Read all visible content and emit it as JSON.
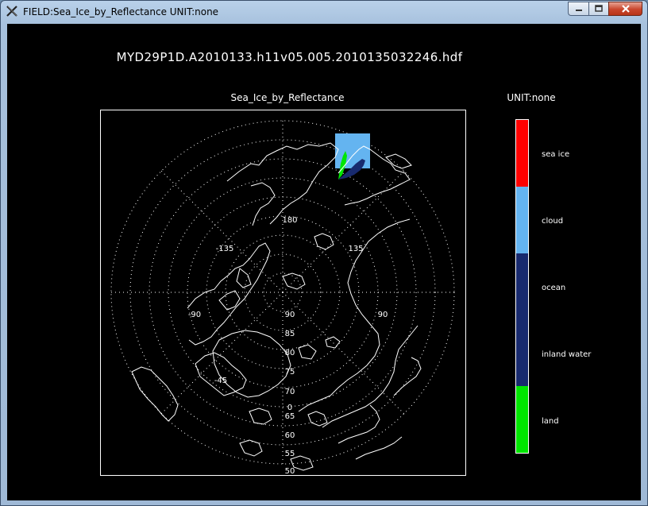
{
  "window": {
    "title": "FIELD:Sea_Ice_by_Reflectance  UNIT:none",
    "app_icon": "x-icon",
    "controls": [
      "minimize-icon",
      "maximize-icon",
      "close-icon"
    ]
  },
  "plot": {
    "file_title": "MYD29P1D.A2010133.h11v05.005.2010135032246.hdf",
    "field_title": "Sea_Ice_by_Reflectance",
    "unit_label": "UNIT:none"
  },
  "map": {
    "projection": "north-polar-stereographic",
    "lon_labels": {
      "n180": "180",
      "nw": "-135",
      "ne": "135",
      "w": "-90",
      "e": "90",
      "sw": "-45"
    },
    "lat_labels_upper": [
      "90",
      "85",
      "80",
      "75",
      "70"
    ],
    "lat_labels_lower": [
      "0",
      "65",
      "60",
      "55",
      "50",
      "45"
    ],
    "colors": {
      "coast": "#ffffff",
      "grid": "#ffffff",
      "cloud": "#64b4f0",
      "land": "#00e600",
      "ocean": "#182a6e"
    }
  },
  "legend": {
    "items": [
      {
        "label": "sea ice",
        "color": "#ff0000"
      },
      {
        "label": "cloud",
        "color": "#64b4f0"
      },
      {
        "label": "ocean",
        "color": "#182a6e"
      },
      {
        "label": "inland water",
        "color": "#182a6e"
      },
      {
        "label": "land",
        "color": "#00e600"
      }
    ]
  }
}
